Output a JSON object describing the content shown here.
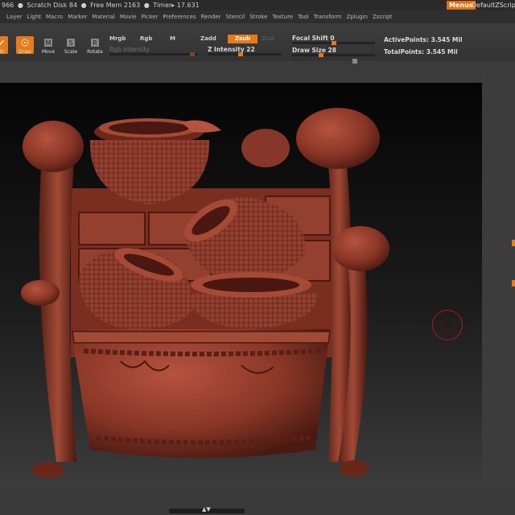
{
  "status": {
    "points": "966",
    "scratch_disk": "Scratch Disk 84",
    "free_mem": "Free Mem 2163",
    "timer": "Timer▸ 17.631"
  },
  "header_right": {
    "menus_label": "Menus",
    "script_name": "DefaultZScript"
  },
  "menu": [
    "Layer",
    "Light",
    "Macro",
    "Marker",
    "Material",
    "Movie",
    "Picker",
    "Preferences",
    "Render",
    "Stencil",
    "Stroke",
    "Texture",
    "Tool",
    "Transform",
    "Zplugin",
    "Zscript"
  ],
  "toolbar": {
    "edit_label": "dit",
    "draw_label": "Draw",
    "move_label": "Move",
    "scale_label": "Scale",
    "rotate_label": "Rotate",
    "mrgb": "Mrgb",
    "rgb": "Rgb",
    "m": "M",
    "zadd": "Zadd",
    "zsub": "Zsub",
    "zcut": "Zcut",
    "rgb_intensity": "Rgb Intensity",
    "z_intensity": "Z Intensity 22",
    "focal_shift": "Focal Shift 0",
    "draw_size": "Draw Size 28",
    "active_points": "ActivePoints: 3.545 Mil",
    "total_points": "TotalPoints: 3.545 Mil"
  },
  "levels": {
    "z_intensity": 22,
    "focal_shift": 0,
    "draw_size": 28
  },
  "colors": {
    "accent": "#e77b1b",
    "model": "#8b3a2a",
    "brush": "#b01818"
  },
  "icons": [
    "edit-icon",
    "draw-icon",
    "move-icon",
    "scale-icon",
    "rotate-icon",
    "brush-cursor-icon"
  ]
}
